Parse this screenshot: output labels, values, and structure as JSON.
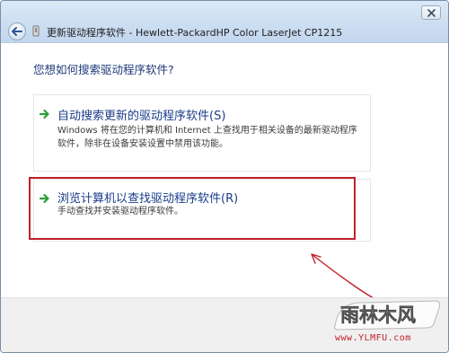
{
  "window": {
    "title": "更新驱动程序软件 - Hewlett-PackardHP Color LaserJet CP1215",
    "back_icon": "back-arrow-icon",
    "close_icon": "close-icon"
  },
  "main": {
    "question": "您想如何搜索驱动程序软件?",
    "options": [
      {
        "title": "自动搜索更新的驱动程序软件(S)",
        "description": "Windows 将在您的计算机和 Internet 上查找用于相关设备的最新驱动程序软件，除非在设备安装设置中禁用该功能。",
        "icon": "green-arrow-icon"
      },
      {
        "title": "浏览计算机以查找驱动程序软件(R)",
        "description": "手动查找并安装驱动程序软件。",
        "icon": "green-arrow-icon",
        "highlighted": true
      }
    ]
  },
  "watermark": {
    "logo_text": "雨林木风",
    "url": "www.YLMFU.com"
  },
  "colors": {
    "highlight": "#c0202a",
    "option_title": "#1a3c8a",
    "arrow_green": "#2e9e3a"
  }
}
